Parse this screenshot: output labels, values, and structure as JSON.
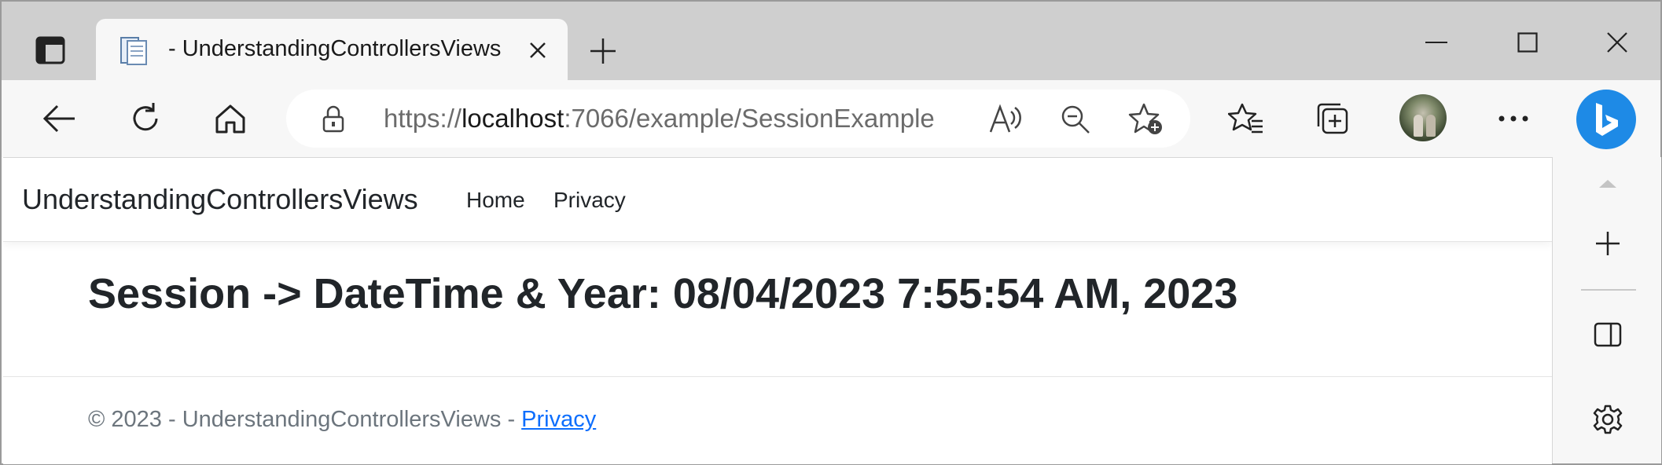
{
  "browser": {
    "tab": {
      "title": "- UnderstandingControllersViews"
    },
    "address": {
      "scheme": "https://",
      "host": "localhost",
      "rest": ":7066/example/SessionExample"
    },
    "icons": {
      "tab_actions": "tab-actions-icon",
      "favicon": "document-icon",
      "close_tab": "close-icon",
      "new_tab": "plus-icon",
      "minimize": "minimize-icon",
      "maximize": "maximize-icon",
      "close_window": "close-icon",
      "back": "back-arrow-icon",
      "refresh": "refresh-icon",
      "home": "home-icon",
      "lock": "lock-icon",
      "read_aloud": "read-aloud-icon",
      "zoom_out": "zoom-out-icon",
      "add_favorite": "add-favorite-icon",
      "favorites": "favorites-icon",
      "collections": "collections-icon",
      "profile": "avatar",
      "more": "more-icon",
      "copilot": "bing-copilot-icon"
    },
    "sidebar": {
      "icons": [
        "scroll-up-icon",
        "plus-icon",
        "split-screen-icon",
        "gear-icon"
      ]
    }
  },
  "page": {
    "navbar": {
      "brand": "UnderstandingControllersViews",
      "links": [
        "Home",
        "Privacy"
      ]
    },
    "heading": "Session -> DateTime & Year: 08/04/2023 7:55:54 AM, 2023",
    "footer": {
      "text": "© 2023 - UnderstandingControllersViews - ",
      "link": "Privacy"
    }
  },
  "colors": {
    "tabstrip_bg": "#cfcfcf",
    "toolbar_bg": "#f7f7f7",
    "link": "#0d6efd",
    "text_dark": "#212529",
    "text_muted": "#6c757d",
    "copilot_blue": "#1e8ae6"
  }
}
